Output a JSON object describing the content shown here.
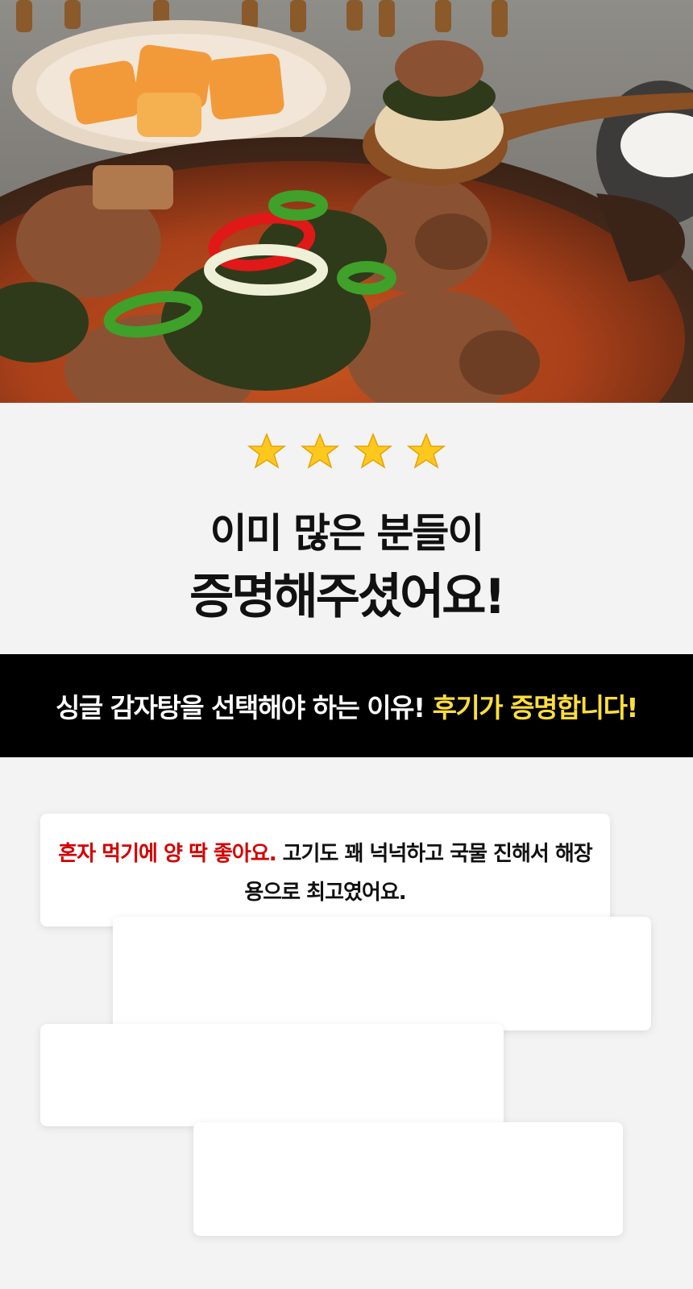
{
  "hero": {
    "icon": "food-photo"
  },
  "rating": {
    "star_count": 4,
    "headline_line1": "이미 많은 분들이",
    "headline_line2": "증명해주셨어요!"
  },
  "banner": {
    "text_white": "싱글 감자탕을 선택해야 하는 이유!",
    "text_yellow": "후기가 증명합니다!",
    "colors": {
      "background": "#000000",
      "highlight": "#ffde3b"
    }
  },
  "reviews": {
    "items": [
      {
        "highlight": "혼자 먹기에 양 딱 좋아요.",
        "text": " 고기도 꽤 넉넉하고 국물 진해서 해장용으로 최고였어요."
      },
      {
        "highlight": "",
        "text": ""
      },
      {
        "highlight": "",
        "text": ""
      },
      {
        "highlight": "",
        "text": ""
      }
    ],
    "colors": {
      "highlight": "#d40000"
    }
  }
}
